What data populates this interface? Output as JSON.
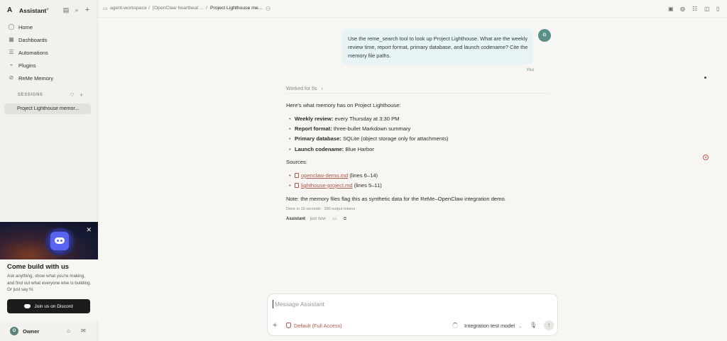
{
  "sidebar": {
    "logo": "A",
    "title": "Assistant",
    "nav": [
      {
        "label": "Home",
        "icon": "home-icon",
        "glyph": "◯"
      },
      {
        "label": "Dashboards",
        "icon": "dashboard-icon",
        "glyph": "▦"
      },
      {
        "label": "Automations",
        "icon": "automation-icon",
        "glyph": "☰"
      },
      {
        "label": "Plugins",
        "icon": "plugin-icon",
        "glyph": "⌁"
      },
      {
        "label": "ReMe Memory",
        "icon": "memory-icon",
        "glyph": "⊘"
      }
    ],
    "sessions_label": "SESSIONS",
    "session_title": "Project Lighthouse memor...",
    "promo": {
      "title": "Come build with us",
      "description": "Ask anything, show what you're making, and find out what everyone else is building. Or just say hi.",
      "button": "Join us on Discord"
    },
    "owner_initial": "O",
    "owner": "Owner"
  },
  "topbar": {
    "breadcrumb": [
      "agent-workspace",
      "[OpenClaw heartbeat ...",
      "Project Lighthouse me..."
    ]
  },
  "chat": {
    "user_message": "Use the reme_search tool to look up Project Lighthouse. What are the weekly review time, report format, primary database, and launch codename? Cite the memory file paths.",
    "user_avatar": "G",
    "user_label": "You",
    "worked_for": "Worked for 5s",
    "intro": "Here's what memory has on Project Lighthouse:",
    "facts": [
      {
        "key": "Weekly review:",
        "value": " every Thursday at 3:30 PM"
      },
      {
        "key": "Report format:",
        "value": " three-bullet Markdown summary"
      },
      {
        "key": "Primary database:",
        "value": " SQLite (object storage only for attachments)"
      },
      {
        "key": "Launch codename:",
        "value": " Blue Harbor"
      }
    ],
    "sources_label": "Sources:",
    "sources": [
      {
        "file": "openclaw-demo.md",
        "lines": " (lines 6–14)"
      },
      {
        "file": "lighthouse-project.md",
        "lines": " (lines 5–11)"
      }
    ],
    "note": "Note: the memory files flag this as synthetic data for the ReMe–OpenClaw integration demo.",
    "meta": "Done in 16 seconds · 390 output tokens",
    "sender": "Assistant",
    "time": "just now"
  },
  "composer": {
    "placeholder": "Message Assistant",
    "access": "Default (Full Access)",
    "model": "Integration test model"
  },
  "colors": {
    "accent": "#b0584a",
    "user_bubble": "#e7f3f4"
  }
}
